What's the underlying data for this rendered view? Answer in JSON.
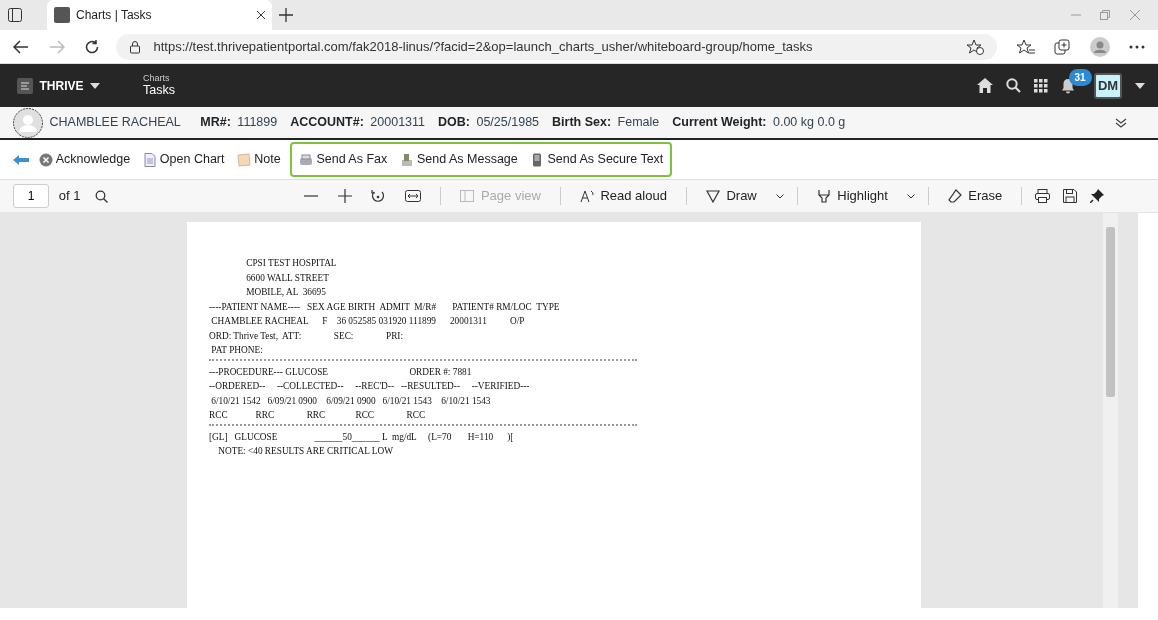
{
  "browser": {
    "tabs": [
      {
        "title": "Charts | Tasks",
        "selected": true
      }
    ],
    "url": "https://test.thrivepatientportal.com/fak2018-linus/?facid=2&op=launch_charts_usher/whiteboard-group/home_tasks"
  },
  "app": {
    "brand": "THRIVE",
    "section": "Charts",
    "page": "Tasks",
    "notifications": "31",
    "user_initials": "DM"
  },
  "patient": {
    "name": "CHAMBLEE RACHEAL",
    "fields": [
      {
        "label": "MR#:",
        "value": "111899"
      },
      {
        "label": "ACCOUNT#:",
        "value": "20001311"
      },
      {
        "label": "DOB:",
        "value": "05/25/1985"
      },
      {
        "label": "Birth Sex:",
        "value": "Female"
      },
      {
        "label": "Current Weight:",
        "value": "0.00 kg 0.0 g"
      }
    ]
  },
  "actions": [
    {
      "label": "Acknowledge"
    },
    {
      "label": "Open Chart"
    },
    {
      "label": "Note"
    }
  ],
  "highlighted_actions": [
    {
      "label": "Send As Fax"
    },
    {
      "label": "Send As Message"
    },
    {
      "label": "Send As Secure Text"
    }
  ],
  "pdf_toolbar": {
    "page": "1",
    "page_count": "of 1",
    "tools": [
      {
        "label": "Page view",
        "disabled": true
      },
      {
        "label": "Read aloud",
        "disabled": false
      },
      {
        "label": "Draw",
        "disabled": false
      },
      {
        "label": "Highlight",
        "disabled": false
      },
      {
        "label": "Erase",
        "disabled": false
      }
    ]
  },
  "document": {
    "lines": [
      {
        "kind": "text",
        "text": "                CPSI TEST HOSPITAL"
      },
      {
        "kind": "text",
        "text": "                6600 WALL STREET"
      },
      {
        "kind": "text",
        "text": "                MOBILE, AL  36695"
      },
      {
        "kind": "text",
        "text": "----PATIENT NAME----   SEX AGE BIRTH  ADMIT  M/R#       PATIENT# RM/LOC  TYPE"
      },
      {
        "kind": "text",
        "text": " CHAMBLEE RACHEAL      F    36 052585 031920 111899      20001311          O/P"
      },
      {
        "kind": "text",
        "text": "ORD: Thrive Test,  ATT:              SEC:              PRI:"
      },
      {
        "kind": "text",
        "text": " PAT PHONE:"
      },
      {
        "kind": "rule"
      },
      {
        "kind": "text",
        "text": "---PROCEDURE--- GLUCOSE                                   ORDER #: 7881"
      },
      {
        "kind": "text",
        "text": "--ORDERED--     --COLLECTED--     --REC'D--   --RESULTED--     --VERIFIED---"
      },
      {
        "kind": "text",
        "text": " 6/10/21 1542   6/09/21 0900    6/09/21 0900   6/10/21 1543    6/10/21 1543"
      },
      {
        "kind": "text",
        "text": "RCC            RRC              RRC             RCC              RCC"
      },
      {
        "kind": "rule"
      },
      {
        "kind": "text",
        "text": "[GL]   GLUCOSE                ______50______ L  mg/dL     (L=70       H=110      )["
      },
      {
        "kind": "text",
        "text": "    NOTE: <40 RESULTS ARE CRITICAL LOW"
      }
    ]
  }
}
